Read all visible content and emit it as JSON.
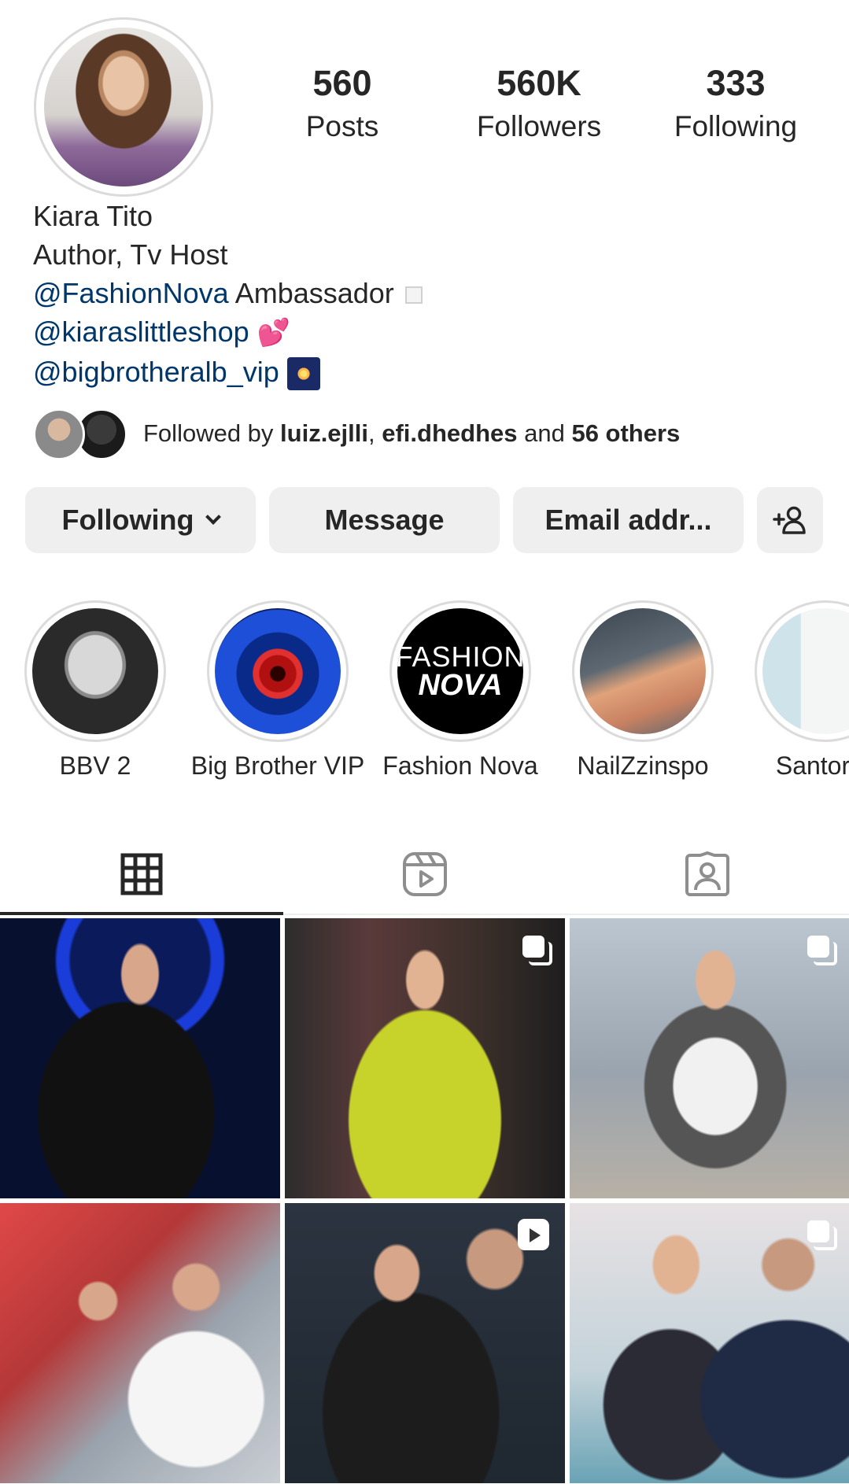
{
  "profile": {
    "name": "Kiara Tito",
    "bio_line1": "Author, Tv Host",
    "bio_link1": "@FashionNova",
    "bio_text1": " Ambassador",
    "bio_link2": "@kiaraslittleshop",
    "bio_link3": "@bigbrotheralb_vip"
  },
  "stats": [
    {
      "value": "560",
      "label": "Posts"
    },
    {
      "value": "560K",
      "label": "Followers"
    },
    {
      "value": "333",
      "label": "Following"
    }
  ],
  "followed_by": {
    "prefix": "Followed by ",
    "user1": "luiz.ejlli",
    "sep": ", ",
    "user2": "efi.dhedhes",
    "and": " and ",
    "others": "56 others"
  },
  "buttons": {
    "following": "Following",
    "message": "Message",
    "email": "Email addr..."
  },
  "highlights": [
    {
      "label": "BBV 2"
    },
    {
      "label": "Big Brother VIP"
    },
    {
      "label": "Fashion Nova",
      "art_line1": "FASHION",
      "art_line2": "NOVA"
    },
    {
      "label": "NailZzinspo"
    },
    {
      "label": "Santorini"
    }
  ],
  "tabs": [
    {
      "icon": "grid-icon",
      "active": true
    },
    {
      "icon": "reels-icon",
      "active": false
    },
    {
      "icon": "tagged-icon",
      "active": false
    }
  ],
  "posts": [
    {
      "badge": "none"
    },
    {
      "badge": "carousel"
    },
    {
      "badge": "carousel"
    },
    {
      "badge": "none"
    },
    {
      "badge": "reel"
    },
    {
      "badge": "carousel"
    }
  ]
}
